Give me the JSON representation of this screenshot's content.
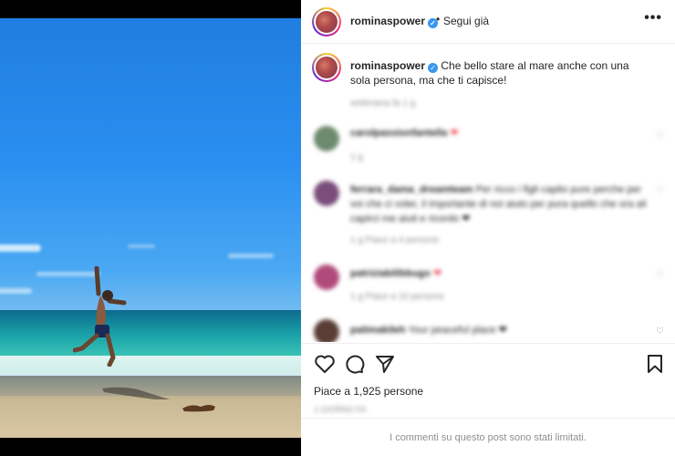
{
  "post": {
    "username": "rominaspower",
    "follow_label": "Segui già",
    "separator": "•",
    "more_label": "•••",
    "caption_text": "Che bello stare al mare anche con una sola persona, ma che ti capisce!",
    "caption_meta": "settimana fa   1 g"
  },
  "comments": [
    {
      "user": "carolpassionfantella",
      "text": "❤",
      "meta": "1 g"
    },
    {
      "user": "ferrara_dama_dreamteam",
      "text": "Per ricco i figli capito pure perche per voi che ci voler, il importante di noi aiuto per pura quello che ora ali capirci me aiuti e ricordo ❤",
      "meta": "1 g     Piace a 4 persone"
    },
    {
      "user": "patriziabilibbugo",
      "text": "❤",
      "meta": "1 g     Piace a 10 persone"
    },
    {
      "user": "patimakileh",
      "text": "Your peaceful place ❤",
      "meta": ""
    }
  ],
  "likes_text": "Piace a 1,925 persone",
  "date_text": "1 GIORNO FA",
  "limited_text": "I commenti su questo post sono stati limitati.",
  "colors": {
    "verified": "#3897f0",
    "heart": "#ed4956",
    "text": "#262626",
    "muted": "#8e8e8e"
  }
}
